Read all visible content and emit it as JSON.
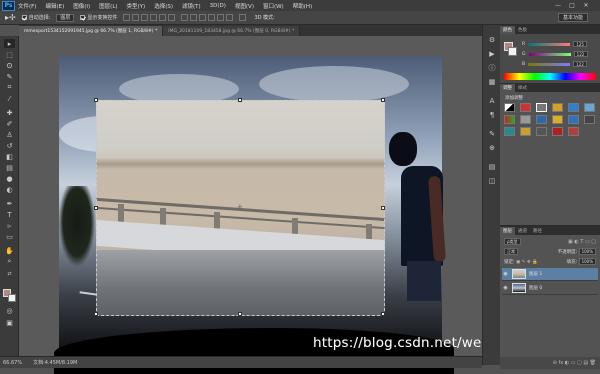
{
  "menubar": {
    "logo": "Ps",
    "items": [
      "文件(F)",
      "编辑(E)",
      "图像(I)",
      "图层(L)",
      "类型(Y)",
      "选择(S)",
      "滤镜(T)",
      "3D(D)",
      "视图(V)",
      "窗口(W)",
      "帮助(H)"
    ],
    "min_glyph": "—",
    "max_glyph": "□",
    "close_glyph": "✕"
  },
  "options": {
    "auto_select_label": "自动选择:",
    "auto_select_value": "图层",
    "show_transform_label": "显示变换控件",
    "workspace": "基本功能"
  },
  "doc_tabs": [
    {
      "title": "mmexport1534152091945.jpg @ 66.7% (图层 1, RGB/8#) *",
      "active": true
    },
    {
      "title": "IMG_20181109_183458.jpg @ 66.7% (图层 0, RGB/8#) *",
      "active": false
    }
  ],
  "status": {
    "zoom": "66.67%",
    "doc_info": "文档:4.45M/8.19M"
  },
  "watermark": "https://blog.csdn.net/weixin_42367680",
  "color_panel": {
    "tabs": [
      "颜色",
      "色板"
    ],
    "r": {
      "label": "R",
      "value": "125"
    },
    "g": {
      "label": "G",
      "value": "122"
    },
    "b": {
      "label": "B",
      "value": "122"
    }
  },
  "adjust_panel": {
    "tabs": [
      "调整",
      "样式"
    ],
    "title": "添加调整"
  },
  "layers_panel": {
    "tabs": [
      "图层",
      "通道",
      "路径"
    ],
    "kind_label": "ρ类型",
    "blend_mode": "正常",
    "opacity_label": "不透明度:",
    "opacity_value": "100%",
    "lock_label": "锁定:",
    "fill_label": "填充:",
    "fill_value": "100%",
    "layers": [
      {
        "name": "图层 1",
        "active": true
      },
      {
        "name": "图层 0",
        "active": false
      }
    ],
    "bottom_icons": "⊖ fx ◐ ▭ ▢ ▤ 🗑"
  },
  "colors": {
    "foreground": "#b08880",
    "background": "#f2f2f2",
    "selected_layer": "#5c7fa4"
  }
}
